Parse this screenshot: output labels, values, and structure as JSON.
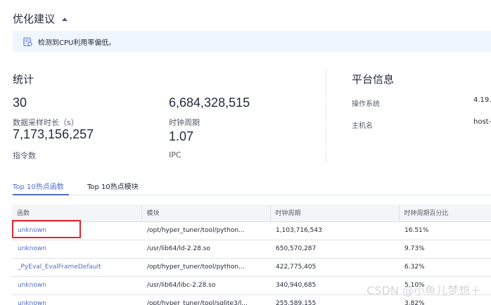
{
  "suggestions": {
    "title": "优化建议",
    "alert_text": "检测到CPU利用率偏低。"
  },
  "stats": {
    "title": "统计",
    "items": [
      {
        "value": "30",
        "label": "数据采样时长（s）"
      },
      {
        "value": "6,684,328,515",
        "label": "时钟周期"
      },
      {
        "value": "7,173,156,257",
        "label": "指令数"
      },
      {
        "value": "1.07",
        "label": "IPC"
      }
    ]
  },
  "platform": {
    "title": "平台信息",
    "os_label": "操作系统",
    "os_value": "4.19.",
    "host_label": "主机名",
    "host_value": "host-"
  },
  "tabs": [
    {
      "label": "Top 10热点函数",
      "active": true
    },
    {
      "label": "Top 10热点模块",
      "active": false
    }
  ],
  "table": {
    "columns": [
      "函数",
      "模块",
      "时钟周期",
      "时钟周期百分比"
    ],
    "rows": [
      [
        "unknown",
        "/opt/hyper_tuner/tool/python...",
        "1,103,716,543",
        "16.51%"
      ],
      [
        "unknown",
        "/usr/lib64/ld-2.28.so",
        "650,570,287",
        "9.73%"
      ],
      [
        "_PyEval_EvalFrameDefault",
        "/opt/hyper_tuner/tool/python...",
        "422,775,405",
        "6.32%"
      ],
      [
        "unknown",
        "/usr/lib64/libc-2.28.so",
        "340,940,685",
        "5.10%"
      ],
      [
        "unknown",
        "/opt/hyper_tuner/tool/sqlite3/l...",
        "255,589,155",
        "3.82%"
      ]
    ]
  },
  "watermark": "CSDN @小鱼儿梦想＋",
  "colors": {
    "accent": "#526ecc",
    "alert_bg": "#f0f6ff",
    "highlight": "#e1262e"
  }
}
